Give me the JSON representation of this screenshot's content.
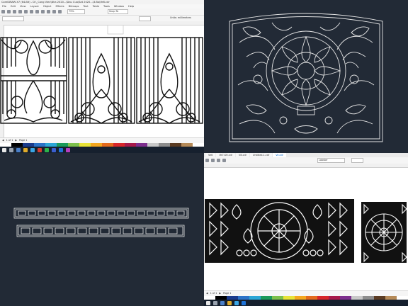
{
  "topleft": {
    "title": "CorelDRAW X7 (64-Bit) - D:\\_Cong Viec\\Nha 2020...\\Dau Cua\\Sat 2020...\\3.Bo\\Ve6.cdr",
    "menu": [
      "File",
      "Edit",
      "View",
      "Layout",
      "Object",
      "Effects",
      "Bitmaps",
      "Text",
      "Table",
      "Tools",
      "Window",
      "Help"
    ],
    "zoom": "79%",
    "snap_label": "Snap To",
    "units_label": "Units: millimeters",
    "page_label": "Page 1",
    "page_count": "1 of 1"
  },
  "bottomright": {
    "tabs": [
      "Ve6",
      "Ve7-KH.cdr",
      "V8.cdr",
      "Untitled-1.cdr",
      "Ve.cdr"
    ],
    "active_tab": 4,
    "page_label": "Page 1",
    "page_count": "1 of 1",
    "font_name": "Lobster"
  },
  "colors": {
    "desktop_bg": "#222a36",
    "line_art": "#e6e6e6",
    "accent_blue": "#1e73d8"
  }
}
